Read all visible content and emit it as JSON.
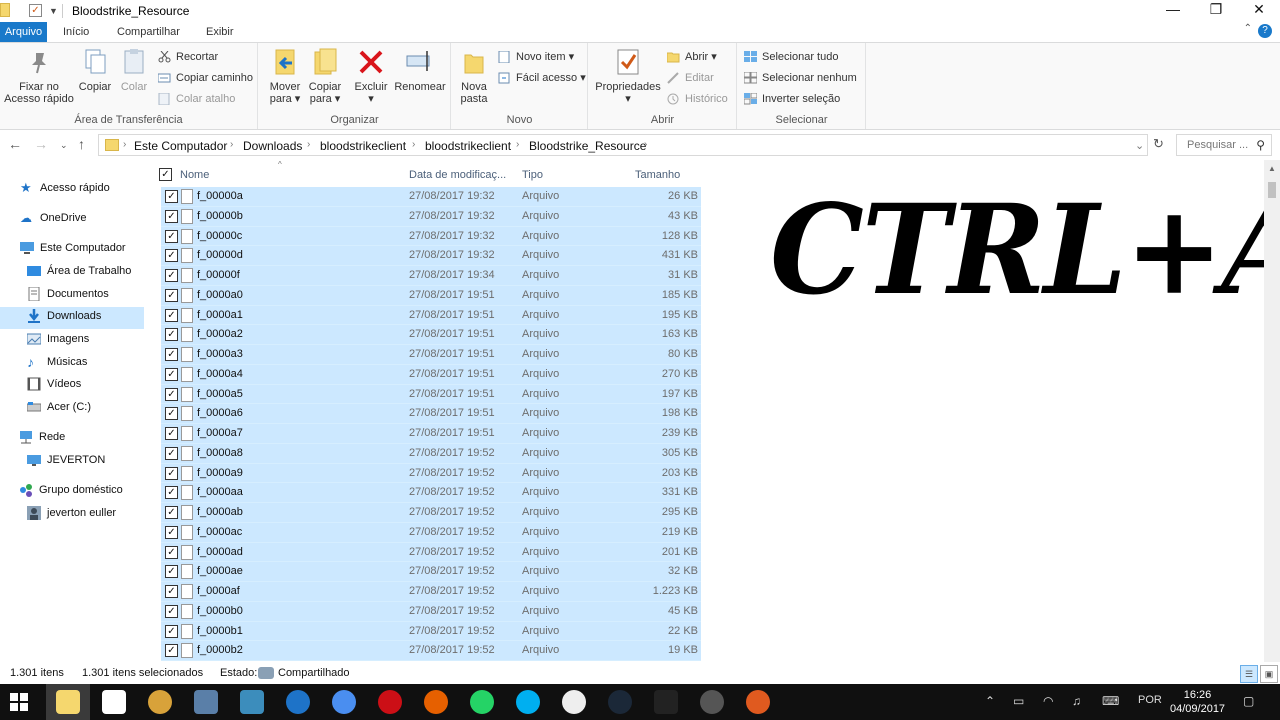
{
  "window": {
    "title": "Bloodstrike_Resource",
    "minimize": "—",
    "maximize": "❐",
    "close": "✕"
  },
  "ribbon_tabs": [
    "Arquivo",
    "Início",
    "Compartilhar",
    "Exibir"
  ],
  "ribbon": {
    "clipboard": {
      "label": "Área de Transferência",
      "pin": "Fixar no Acesso rápido",
      "copy": "Copiar",
      "paste": "Colar",
      "cut": "Recortar",
      "copy_path": "Copiar caminho",
      "paste_shortcut": "Colar atalho"
    },
    "organize": {
      "label": "Organizar",
      "move_to": "Mover para ▾",
      "copy_to": "Copiar para ▾",
      "delete": "Excluir ▾",
      "rename": "Renomear"
    },
    "new": {
      "label": "Novo",
      "new_folder": "Nova pasta",
      "new_item": "Novo item ▾",
      "easy_access": "Fácil acesso ▾"
    },
    "open": {
      "label": "Abrir",
      "properties": "Propriedades ▾",
      "open": "Abrir ▾",
      "edit": "Editar",
      "history": "Histórico"
    },
    "select": {
      "label": "Selecionar",
      "select_all": "Selecionar tudo",
      "select_none": "Selecionar nenhum",
      "invert": "Inverter seleção"
    }
  },
  "breadcrumb": [
    "Este Computador",
    "Downloads",
    "bloodstrikeclient",
    "bloodstrikeclient",
    "Bloodstrike_Resource"
  ],
  "search": {
    "placeholder": "Pesquisar ..."
  },
  "nav": {
    "quick_access": "Acesso rápido",
    "onedrive": "OneDrive",
    "this_pc": "Este Computador",
    "desktop": "Área de Trabalho",
    "documents": "Documentos",
    "downloads": "Downloads",
    "images": "Imagens",
    "music": "Músicas",
    "videos": "Vídeos",
    "drive_c": "Acer (C:)",
    "network": "Rede",
    "jeverton_pc": "JEVERTON",
    "homegroup": "Grupo doméstico",
    "user": "jeverton euller"
  },
  "columns": {
    "name": "Nome",
    "date": "Data de modificaç...",
    "type": "Tipo",
    "size": "Tamanho"
  },
  "files": [
    {
      "name": "f_00000a",
      "date": "27/08/2017 19:32",
      "type": "Arquivo",
      "size": "26 KB"
    },
    {
      "name": "f_00000b",
      "date": "27/08/2017 19:32",
      "type": "Arquivo",
      "size": "43 KB"
    },
    {
      "name": "f_00000c",
      "date": "27/08/2017 19:32",
      "type": "Arquivo",
      "size": "128 KB"
    },
    {
      "name": "f_00000d",
      "date": "27/08/2017 19:32",
      "type": "Arquivo",
      "size": "431 KB"
    },
    {
      "name": "f_00000f",
      "date": "27/08/2017 19:34",
      "type": "Arquivo",
      "size": "31 KB"
    },
    {
      "name": "f_0000a0",
      "date": "27/08/2017 19:51",
      "type": "Arquivo",
      "size": "185 KB"
    },
    {
      "name": "f_0000a1",
      "date": "27/08/2017 19:51",
      "type": "Arquivo",
      "size": "195 KB"
    },
    {
      "name": "f_0000a2",
      "date": "27/08/2017 19:51",
      "type": "Arquivo",
      "size": "163 KB"
    },
    {
      "name": "f_0000a3",
      "date": "27/08/2017 19:51",
      "type": "Arquivo",
      "size": "80 KB"
    },
    {
      "name": "f_0000a4",
      "date": "27/08/2017 19:51",
      "type": "Arquivo",
      "size": "270 KB"
    },
    {
      "name": "f_0000a5",
      "date": "27/08/2017 19:51",
      "type": "Arquivo",
      "size": "197 KB"
    },
    {
      "name": "f_0000a6",
      "date": "27/08/2017 19:51",
      "type": "Arquivo",
      "size": "198 KB"
    },
    {
      "name": "f_0000a7",
      "date": "27/08/2017 19:51",
      "type": "Arquivo",
      "size": "239 KB"
    },
    {
      "name": "f_0000a8",
      "date": "27/08/2017 19:52",
      "type": "Arquivo",
      "size": "305 KB"
    },
    {
      "name": "f_0000a9",
      "date": "27/08/2017 19:52",
      "type": "Arquivo",
      "size": "203 KB"
    },
    {
      "name": "f_0000aa",
      "date": "27/08/2017 19:52",
      "type": "Arquivo",
      "size": "331 KB"
    },
    {
      "name": "f_0000ab",
      "date": "27/08/2017 19:52",
      "type": "Arquivo",
      "size": "295 KB"
    },
    {
      "name": "f_0000ac",
      "date": "27/08/2017 19:52",
      "type": "Arquivo",
      "size": "219 KB"
    },
    {
      "name": "f_0000ad",
      "date": "27/08/2017 19:52",
      "type": "Arquivo",
      "size": "201 KB"
    },
    {
      "name": "f_0000ae",
      "date": "27/08/2017 19:52",
      "type": "Arquivo",
      "size": "32 KB"
    },
    {
      "name": "f_0000af",
      "date": "27/08/2017 19:52",
      "type": "Arquivo",
      "size": "1.223 KB"
    },
    {
      "name": "f_0000b0",
      "date": "27/08/2017 19:52",
      "type": "Arquivo",
      "size": "45 KB"
    },
    {
      "name": "f_0000b1",
      "date": "27/08/2017 19:52",
      "type": "Arquivo",
      "size": "22 KB"
    },
    {
      "name": "f_0000b2",
      "date": "27/08/2017 19:52",
      "type": "Arquivo",
      "size": "19 KB"
    }
  ],
  "overlay_text": "CTRL+A",
  "status": {
    "count": "1.301 itens",
    "selected": "1.301 itens selecionados",
    "state_label": "Estado:",
    "state_value": "Compartilhado"
  },
  "taskbar": {
    "lang": "POR",
    "time": "16:26",
    "date": "04/09/2017"
  },
  "colors": {
    "accent": "#1979ca",
    "selection": "#cce8ff",
    "taskbar": "#101010"
  }
}
